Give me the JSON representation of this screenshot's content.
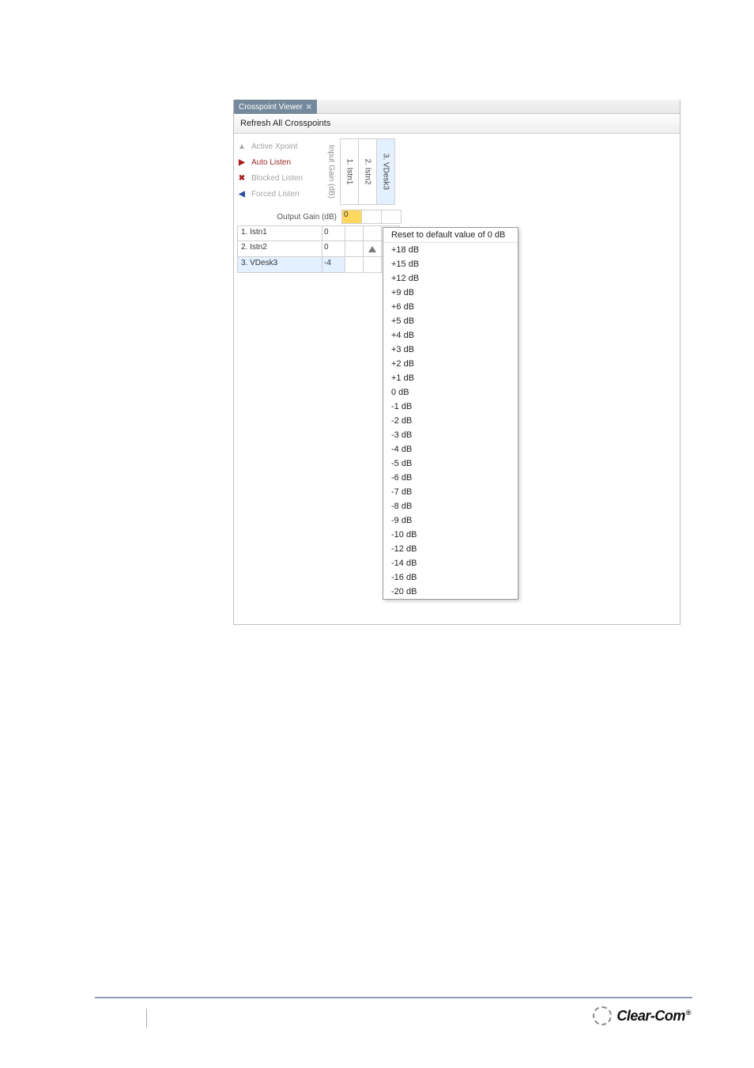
{
  "tab": {
    "title": "Crosspoint Viewer"
  },
  "toolbar": {
    "refresh": "Refresh All Crosspoints"
  },
  "legend": {
    "active": "Active Xpoint",
    "auto": "Auto Listen",
    "blocked": "Blocked Listen",
    "forced": "Forced Listen"
  },
  "input_gain_label": "Input Gain (dB)",
  "output_gain_label": "Output Gain (dB)",
  "columns": [
    {
      "label": "1. Istn1"
    },
    {
      "label": "2. Istn2"
    },
    {
      "label": "3. VDesk3"
    }
  ],
  "input_gains": [
    "0",
    "",
    ""
  ],
  "rows": [
    {
      "label": "1. Istn1",
      "gain": "0",
      "cells": [
        "",
        "",
        ""
      ]
    },
    {
      "label": "2. Istn2",
      "gain": "0",
      "cells": [
        "",
        "up",
        ""
      ]
    },
    {
      "label": "3. VDesk3",
      "gain": "-4",
      "cells": [
        "",
        "",
        ""
      ]
    }
  ],
  "menu": {
    "reset": "Reset to default value of 0 dB",
    "items": [
      "+18 dB",
      "+15 dB",
      "+12 dB",
      "+9 dB",
      "+6 dB",
      "+5 dB",
      "+4 dB",
      "+3 dB",
      "+2 dB",
      "+1 dB",
      "0 dB",
      "-1 dB",
      "-2 dB",
      "-3 dB",
      "-4 dB",
      "-5 dB",
      "-6 dB",
      "-7 dB",
      "-8 dB",
      "-9 dB",
      "-10 dB",
      "-12 dB",
      "-14 dB",
      "-16 dB",
      "-20 dB"
    ]
  },
  "footer": {
    "brand": "Clear-Com",
    "reg": "®"
  }
}
